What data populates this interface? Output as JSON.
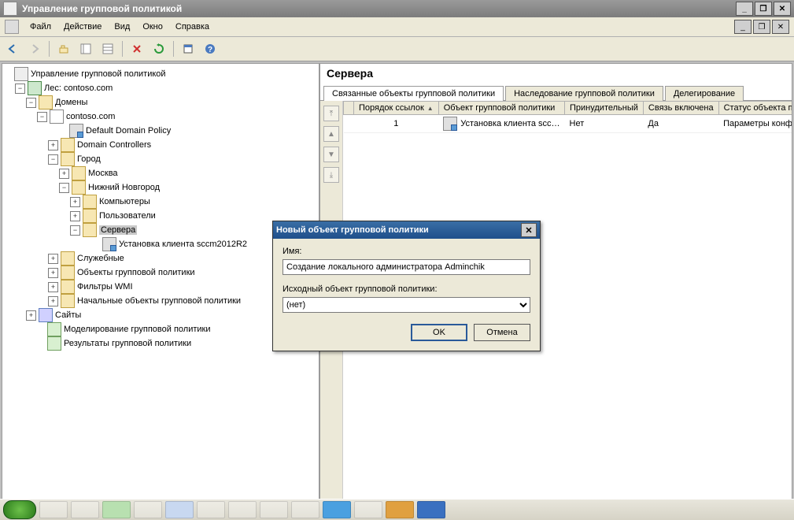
{
  "window": {
    "title": "Управление групповой политикой"
  },
  "menu": {
    "file": "Файл",
    "action": "Действие",
    "view": "Вид",
    "window": "Окно",
    "help": "Справка"
  },
  "tree": {
    "root": "Управление групповой политикой",
    "forest": "Лес: contoso.com",
    "domains": "Домены",
    "domain": "contoso.com",
    "ddp": "Default Domain Policy",
    "dc": "Domain Controllers",
    "city": "Город",
    "moscow": "Москва",
    "nn": "Нижний Новгород",
    "computers": "Компьютеры",
    "users": "Пользователи",
    "servers": "Сервера",
    "sccm": "Установка клиента sccm2012R2",
    "service": "Служебные",
    "gpos": "Объекты групповой политики",
    "wmi": "Фильтры WMI",
    "starter": "Начальные объекты групповой политики",
    "sites": "Сайты",
    "modeling": "Моделирование групповой политики",
    "results": "Результаты групповой политики"
  },
  "right": {
    "title": "Сервера",
    "tab_linked": "Связанные объекты групповой политики",
    "tab_inherit": "Наследование групповой политики",
    "tab_deleg": "Делегирование",
    "col_order": "Порядок ссылок",
    "col_gpo": "Объект групповой политики",
    "col_enforced": "Принудительный",
    "col_linkenabled": "Связь включена",
    "col_status": "Статус объекта п",
    "row1_order": "1",
    "row1_gpo": "Установка клиента scc…",
    "row1_enforced": "Нет",
    "row1_link": "Да",
    "row1_status": "Параметры конф"
  },
  "dialog": {
    "title": "Новый объект групповой политики",
    "name_label": "Имя:",
    "name_value": "Создание локального администратора Adminchik",
    "source_label": "Исходный объект групповой политики:",
    "source_value": "(нет)",
    "ok": "OK",
    "cancel": "Отмена"
  }
}
